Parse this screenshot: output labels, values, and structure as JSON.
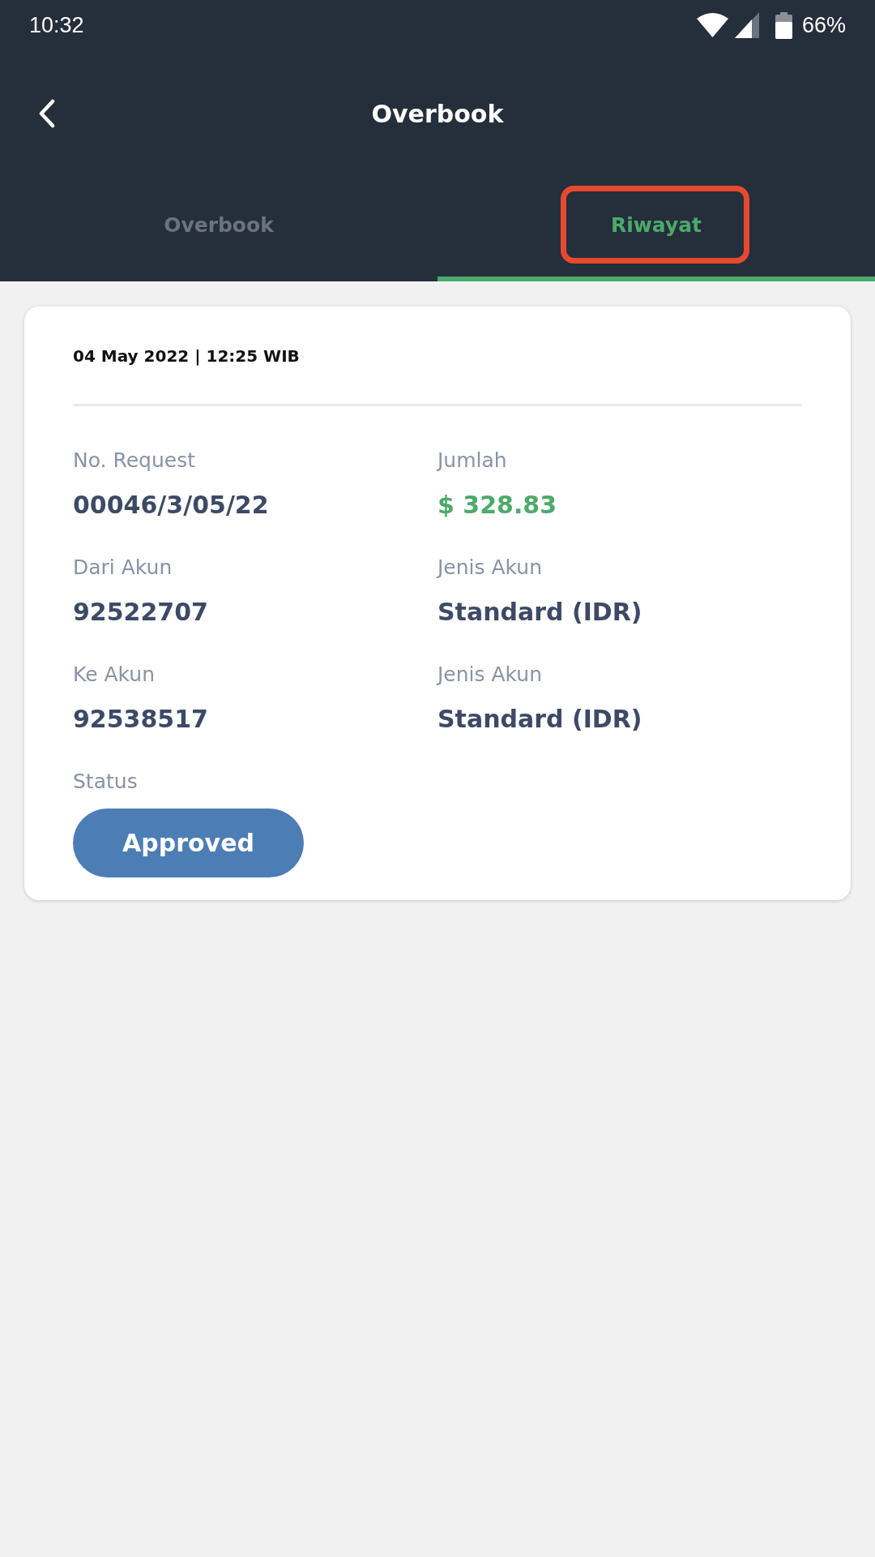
{
  "status_bar": {
    "time": "10:32",
    "battery": "66%"
  },
  "header": {
    "title": "Overbook"
  },
  "tabs": [
    {
      "label": "Overbook",
      "selected": false,
      "highlighted": false
    },
    {
      "label": "Riwayat",
      "selected": true,
      "highlighted": true
    }
  ],
  "transaction": {
    "datetime": "04 May 2022 | 12:25 WIB",
    "fields": [
      {
        "label": "No. Request",
        "value": "00046/3/05/22",
        "kind": "text"
      },
      {
        "label": "Jumlah",
        "value": "$ 328.83",
        "kind": "amount"
      },
      {
        "label": "Dari Akun",
        "value": "92522707",
        "kind": "text"
      },
      {
        "label": "Jenis Akun",
        "value": "Standard (IDR)",
        "kind": "text"
      },
      {
        "label": "Ke Akun",
        "value": "92538517",
        "kind": "text"
      },
      {
        "label": "Jenis Akun",
        "value": "Standard (IDR)",
        "kind": "text"
      }
    ],
    "status": {
      "label": "Status",
      "value": "Approved"
    }
  }
}
